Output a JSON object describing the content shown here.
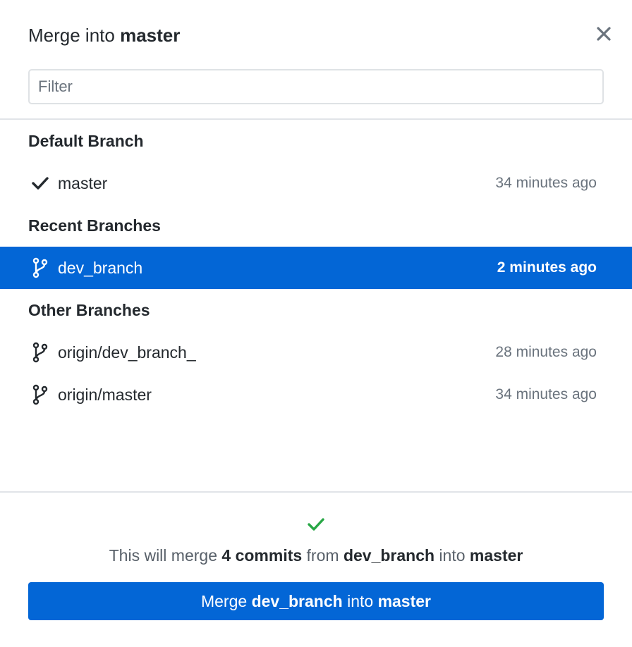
{
  "dialog": {
    "title_prefix": "Merge into ",
    "title_target": "master",
    "close_icon": "close-icon"
  },
  "filter": {
    "placeholder": "Filter",
    "value": ""
  },
  "sections": {
    "default": {
      "header": "Default Branch",
      "branches": [
        {
          "name": "master",
          "time": "34 minutes ago",
          "icon": "check-icon"
        }
      ]
    },
    "recent": {
      "header": "Recent Branches",
      "branches": [
        {
          "name": "dev_branch",
          "time": "2 minutes ago",
          "icon": "git-branch-icon",
          "selected": true
        }
      ]
    },
    "other": {
      "header": "Other Branches",
      "branches": [
        {
          "name": "origin/dev_branch_",
          "time": "28 minutes ago",
          "icon": "git-branch-icon"
        },
        {
          "name": "origin/master",
          "time": "34 minutes ago",
          "icon": "git-branch-icon"
        }
      ]
    }
  },
  "status": {
    "icon": "check-icon",
    "prefix": "This will merge ",
    "count": "4 commits",
    "mid1": " from ",
    "source": "dev_branch",
    "mid2": " into ",
    "target": "master"
  },
  "merge_button": {
    "prefix": "Merge ",
    "source": "dev_branch",
    "mid": " into ",
    "target": "master"
  },
  "colors": {
    "accent": "#0366d6",
    "success": "#28a745",
    "muted_text": "#6a737d",
    "divider": "#e1e4e8"
  }
}
